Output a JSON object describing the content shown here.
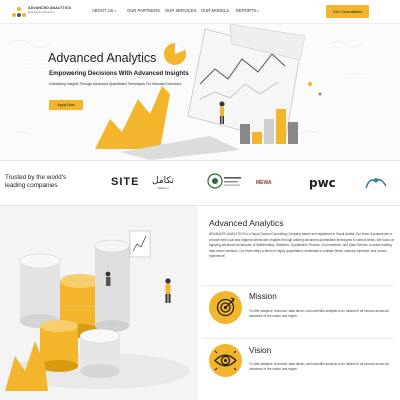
{
  "nav": {
    "logo_name": "ADVANCED ANALYTICS",
    "logo_sub": "Empowering Decisions",
    "items": [
      {
        "label": "ABOUT US",
        "has_dropdown": true
      },
      {
        "label": "OUR PARTNERS",
        "has_dropdown": false
      },
      {
        "label": "OUR SERVICES",
        "has_dropdown": false
      },
      {
        "label": "OUR MODELS",
        "has_dropdown": false
      },
      {
        "label": "REPORTS",
        "has_dropdown": true
      }
    ],
    "cta_label": "Get Consultation",
    "chevron": "▾"
  },
  "hero": {
    "title": "Advanced Analytics",
    "subtitle": "Empowering Decisions With Advanced Insights",
    "text": "Unleashing Insights Through Advanced Quantitative Techniques For Informed Decisions",
    "apply_label": "Apply Now"
  },
  "trusted": {
    "title": "Trusted by the world's leading companies",
    "partners": [
      {
        "name": "SITE",
        "icon": "site-logo"
      },
      {
        "name": "تكامل",
        "sub": "Takamol",
        "icon": "takamol-logo"
      },
      {
        "name": "seal-logo",
        "icon": "seal-logo"
      },
      {
        "name": "MEWA",
        "icon": "mewa-logo"
      },
      {
        "name": "pwc",
        "icon": "pwc-logo"
      },
      {
        "name": "emblem-logo",
        "icon": "emblem-logo"
      }
    ]
  },
  "about": {
    "title": "Advanced Analytics",
    "text": "ADVANCED ANALYTICS is a Saudi Owned Consulting Company based and registered in Saudi Arabia. Our team is passionate to provide their local and regional clients with insights through utilizing advanced quantitative techniques in various fields. We focus on applying advanced techniques of Mathematics, Statistics, Quantitative Finance, Econometrics, and Data Science to assist making data driven decision. Our team offers a blend of highly quantitative credentials in multiple fields, industry expertise, and proven experience."
  },
  "mission": {
    "title": "Mission",
    "text": "To offer adaptive, technical, data driven, and scientific analysis to be utilized in all sectors across all industries of the nation and region.",
    "icon": "target-icon"
  },
  "vision": {
    "title": "Vision",
    "text": "To offer adaptive, technical, data driven, and scientific analysis to be utilized in all sectors across all industries of the nation and region.",
    "icon": "eye-icon"
  },
  "colors": {
    "accent": "#f2b52b",
    "text": "#222222",
    "light_bg": "#f4f4f4"
  }
}
